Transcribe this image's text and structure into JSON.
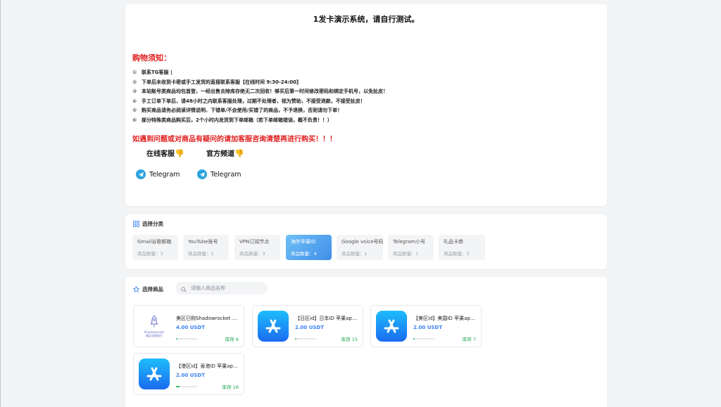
{
  "notice": {
    "title": "1发卡演示系统，请自行测试。",
    "shop_heading": "购物须知：",
    "rules": [
      {
        "num": "①",
        "text": "联系TG客服 |"
      },
      {
        "num": "②",
        "text": "下单后未收到卡密或手工发货的直接联系客服【在线时间 9:30-24:00】"
      },
      {
        "num": "③",
        "text": "本站账号类商品均包首登，一经出售去除库存绝无二次回收！够买后第一时间修改密码和绑定手机号，以免扯皮！"
      },
      {
        "num": "④",
        "text": "手工订单下单后，请48小时之内联系客服处理，过期不处理者，视为赞助，不接受退款，不接受扯皮！"
      },
      {
        "num": "⑤",
        "text": "购买商品请务必阅读详情说明、下错单/不会使用/买错了的商品，不予退换，否则请勿下单！"
      },
      {
        "num": "⑥",
        "text": "部分特殊类商品购买后，2个小时内发货到下单邮箱（若下单邮箱错误，概不负责！！）"
      }
    ],
    "warning": "如遇到问题或对商品有疑问的请加客服咨询清楚再进行购买！！！",
    "online_service_label": "在线客服",
    "official_channel_label": "官方频道",
    "hand_icon": "👎",
    "telegram_label_1": "Telegram",
    "telegram_label_2": "Telegram"
  },
  "categories": {
    "title": "选择分类",
    "items": [
      {
        "name": "Gmail谷歌邮箱",
        "count": "商品数量：3"
      },
      {
        "name": "YouTube账号",
        "count": "商品数量：1"
      },
      {
        "name": "VPN订阅节点",
        "count": "商品数量：3"
      },
      {
        "name": "海外苹果ID",
        "count": "商品数量：4",
        "active": true
      },
      {
        "name": "Google voice号码",
        "count": "商品数量：1"
      },
      {
        "name": "Telegram小号",
        "count": "商品数量：1"
      },
      {
        "name": "礼品卡券",
        "count": "商品数量：2"
      }
    ]
  },
  "products": {
    "title": "选择商品",
    "search_placeholder": "请输入商品名称",
    "items": [
      {
        "name": "美区已购Shadowrocket 小火箭",
        "price": "4.00 USDT",
        "stock": "库存 6",
        "progress": 0.08,
        "thumb_caption_1": "Shadowrocket",
        "thumb_caption_2": "美区加购账号"
      },
      {
        "name": "【日区id】日本ID 苹果apple id",
        "price": "2.00 USDT",
        "stock": "库存 15",
        "progress": 0.08
      },
      {
        "name": "【美区id】美国ID 苹果apple id",
        "price": "2.00 USDT",
        "stock": "库存 7",
        "progress": 0.05
      },
      {
        "name": "【港区id】香港ID 苹果apple id",
        "price": "2.00 USDT",
        "stock": "库存 16",
        "progress": 0.15
      }
    ]
  },
  "colors": {
    "accent": "#3b82f6",
    "warning_red": "#e11d1d",
    "stock_green": "#16a34a",
    "telegram_blue": "#2aa3de"
  }
}
